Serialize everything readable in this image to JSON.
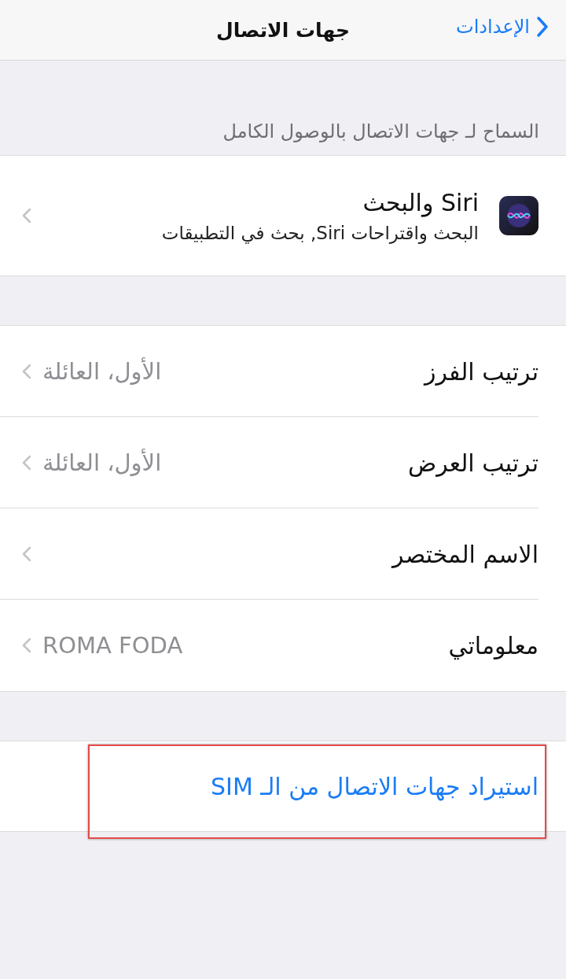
{
  "nav": {
    "back_label": "الإعدادات",
    "title": "جهات الاتصال"
  },
  "section_header": "السماح لـ جهات الاتصال بالوصول الكامل",
  "siri_row": {
    "title": "Siri والبحث",
    "subtitle": "البحث واقتراحات Siri, بحث في التطبيقات"
  },
  "settings_rows": [
    {
      "label": "ترتيب الفرز",
      "value": "الأول، العائلة"
    },
    {
      "label": "ترتيب العرض",
      "value": "الأول، العائلة"
    },
    {
      "label": "الاسم المختصر"
    },
    {
      "label": "معلوماتي",
      "value": "ROMA FODA"
    }
  ],
  "import_row": {
    "label": "استيراد جهات الاتصال من الـ SIM",
    "highlighted": true
  }
}
